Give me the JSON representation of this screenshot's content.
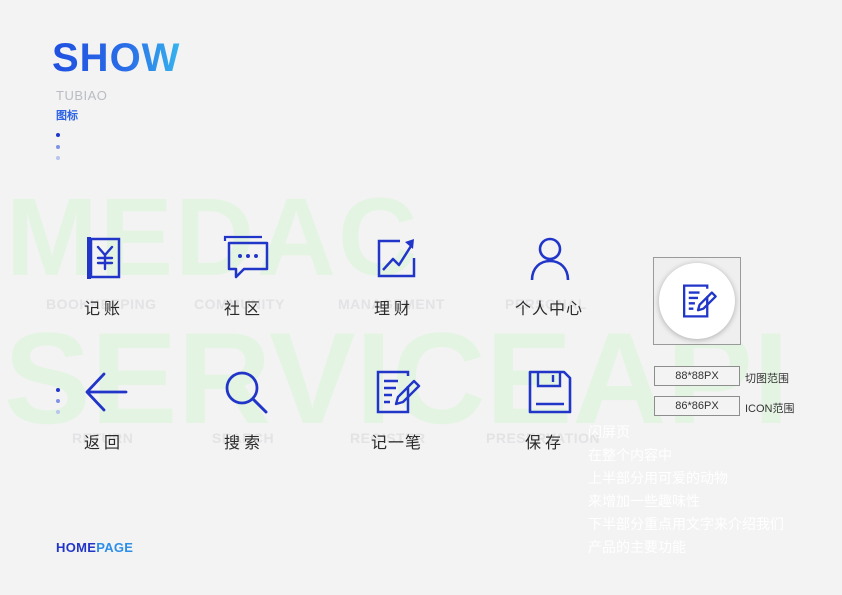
{
  "header": {
    "title": "SHOW",
    "subtitle": "TUBIAO",
    "subtitle_cn": "图标"
  },
  "watermark": {
    "line1": "MEDAC",
    "line2": "SERVICEAPI"
  },
  "icons": [
    {
      "id": "bookkeeping",
      "icon": "ledger-yen-icon",
      "en": "BOOKKEEPING",
      "cn": "记账"
    },
    {
      "id": "community",
      "icon": "chat-bubble-icon",
      "en": "COMMUNITY",
      "cn": "社区"
    },
    {
      "id": "management",
      "icon": "finance-chart-icon",
      "en": "MANAGEMENT",
      "cn": "理财"
    },
    {
      "id": "personal",
      "icon": "user-icon",
      "en": "PERSONAL",
      "cn": "个人中心"
    },
    {
      "id": "return",
      "icon": "arrow-left-icon",
      "en": "RETURN",
      "cn": "返回"
    },
    {
      "id": "search",
      "icon": "search-icon",
      "en": "SEARCH",
      "cn": "搜索"
    },
    {
      "id": "register",
      "icon": "note-pen-icon",
      "en": "REGISTER",
      "cn": "记一笔"
    },
    {
      "id": "preservation",
      "icon": "save-disk-icon",
      "en": "PRESERVATION",
      "cn": "保存"
    }
  ],
  "specs": {
    "cut_size": "88*88PX",
    "cut_label": "切图范围",
    "icon_size": "86*86PX",
    "icon_label": "ICON范围"
  },
  "description": {
    "lines": [
      "闪屏页",
      "在整个内容中",
      "上半部分用可爱的动物",
      "来增加一些趣味性",
      "下半部分重点用文字来介绍我们",
      "产品的主要功能"
    ]
  },
  "footer": {
    "home": "HOME",
    "page": "PAGE"
  },
  "colors": {
    "primary": "#2136c9",
    "accent": "#2d63e4",
    "light_accent": "#35b4ee"
  }
}
